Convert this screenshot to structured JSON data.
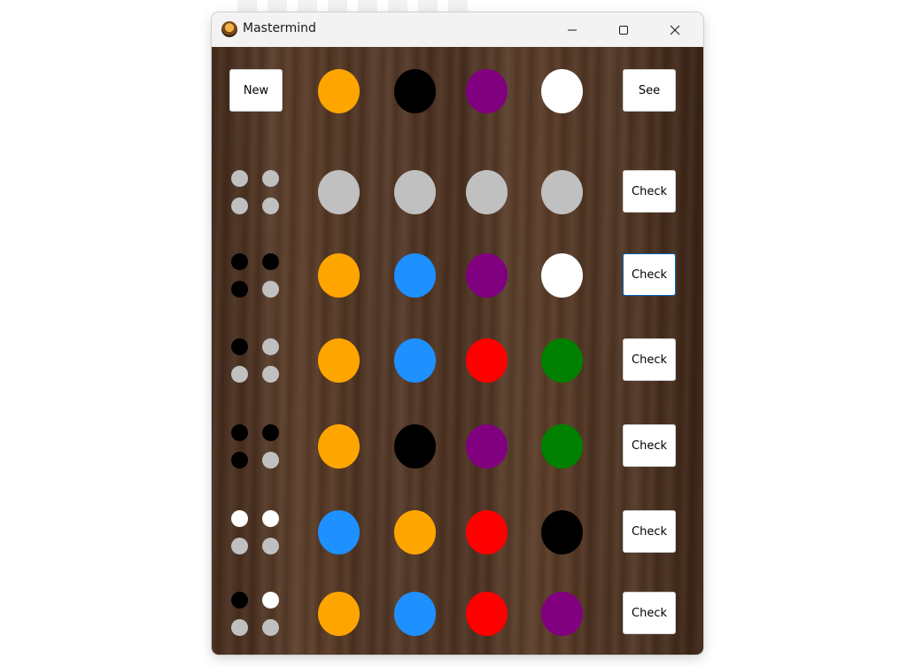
{
  "window": {
    "title": "Mastermind",
    "icon": "mastermind-app-icon"
  },
  "colors": {
    "orange": "#FFA500",
    "black": "#000000",
    "purple": "#800080",
    "white": "#FFFFFF",
    "gray": "#C0C0C0",
    "blue": "#1E90FF",
    "red": "#FF0000",
    "green": "#008000"
  },
  "top_row": {
    "new_label": "New",
    "see_label": "See",
    "secret": [
      "orange",
      "black",
      "purple",
      "white"
    ]
  },
  "rows": [
    {
      "guess": [
        "gray",
        "gray",
        "gray",
        "gray"
      ],
      "feedback": [
        "gray",
        "gray",
        "gray",
        "gray"
      ],
      "check_label": "Check",
      "focused": false
    },
    {
      "guess": [
        "orange",
        "blue",
        "purple",
        "white"
      ],
      "feedback": [
        "black",
        "black",
        "black",
        "gray"
      ],
      "check_label": "Check",
      "focused": true
    },
    {
      "guess": [
        "orange",
        "blue",
        "red",
        "green"
      ],
      "feedback": [
        "black",
        "gray",
        "gray",
        "gray"
      ],
      "check_label": "Check",
      "focused": false
    },
    {
      "guess": [
        "orange",
        "black",
        "purple",
        "green"
      ],
      "feedback": [
        "black",
        "black",
        "black",
        "gray"
      ],
      "check_label": "Check",
      "focused": false
    },
    {
      "guess": [
        "blue",
        "orange",
        "red",
        "black"
      ],
      "feedback": [
        "white",
        "white",
        "gray",
        "gray"
      ],
      "check_label": "Check",
      "focused": false
    },
    {
      "guess": [
        "orange",
        "blue",
        "red",
        "purple"
      ],
      "feedback": [
        "black",
        "white",
        "gray",
        "gray"
      ],
      "check_label": "Check",
      "focused": false
    }
  ]
}
